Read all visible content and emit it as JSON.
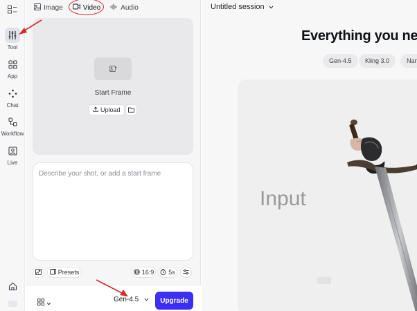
{
  "rail": {
    "items": [
      {
        "label": "Tool",
        "icon": "sliders-icon",
        "active": true
      },
      {
        "label": "App",
        "icon": "grid-icon",
        "active": false
      },
      {
        "label": "Chat",
        "icon": "nodes-icon",
        "active": false
      },
      {
        "label": "Workflow",
        "icon": "workflow-icon",
        "active": false
      },
      {
        "label": "Live",
        "icon": "live-icon",
        "active": false
      }
    ]
  },
  "panel": {
    "tabs": [
      {
        "label": "Image",
        "icon": "image-icon"
      },
      {
        "label": "Video",
        "icon": "video-icon",
        "active": true
      },
      {
        "label": "Audio",
        "icon": "waveform-icon"
      }
    ],
    "start_frame": {
      "title": "Start Frame",
      "upload_label": "Upload"
    },
    "prompt": {
      "placeholder": "Describe your shot, or add a start frame"
    },
    "chips": {
      "presets": "Presets",
      "aspect": "16:9",
      "duration": "5s"
    },
    "footer": {
      "model": "Gen-4.5",
      "upgrade": "Upgrade"
    }
  },
  "main": {
    "session_title": "Untitled session",
    "headline": "Everything you nee",
    "model_chips": [
      "Gen-4.5",
      "Kling 3.0",
      "Nan"
    ],
    "preview_label": "Input"
  },
  "colors": {
    "accent": "#3b2ff5",
    "annotation": "#d62d2d",
    "panel_bg": "#f6f6f7",
    "main_bg": "#f7f7f8"
  }
}
